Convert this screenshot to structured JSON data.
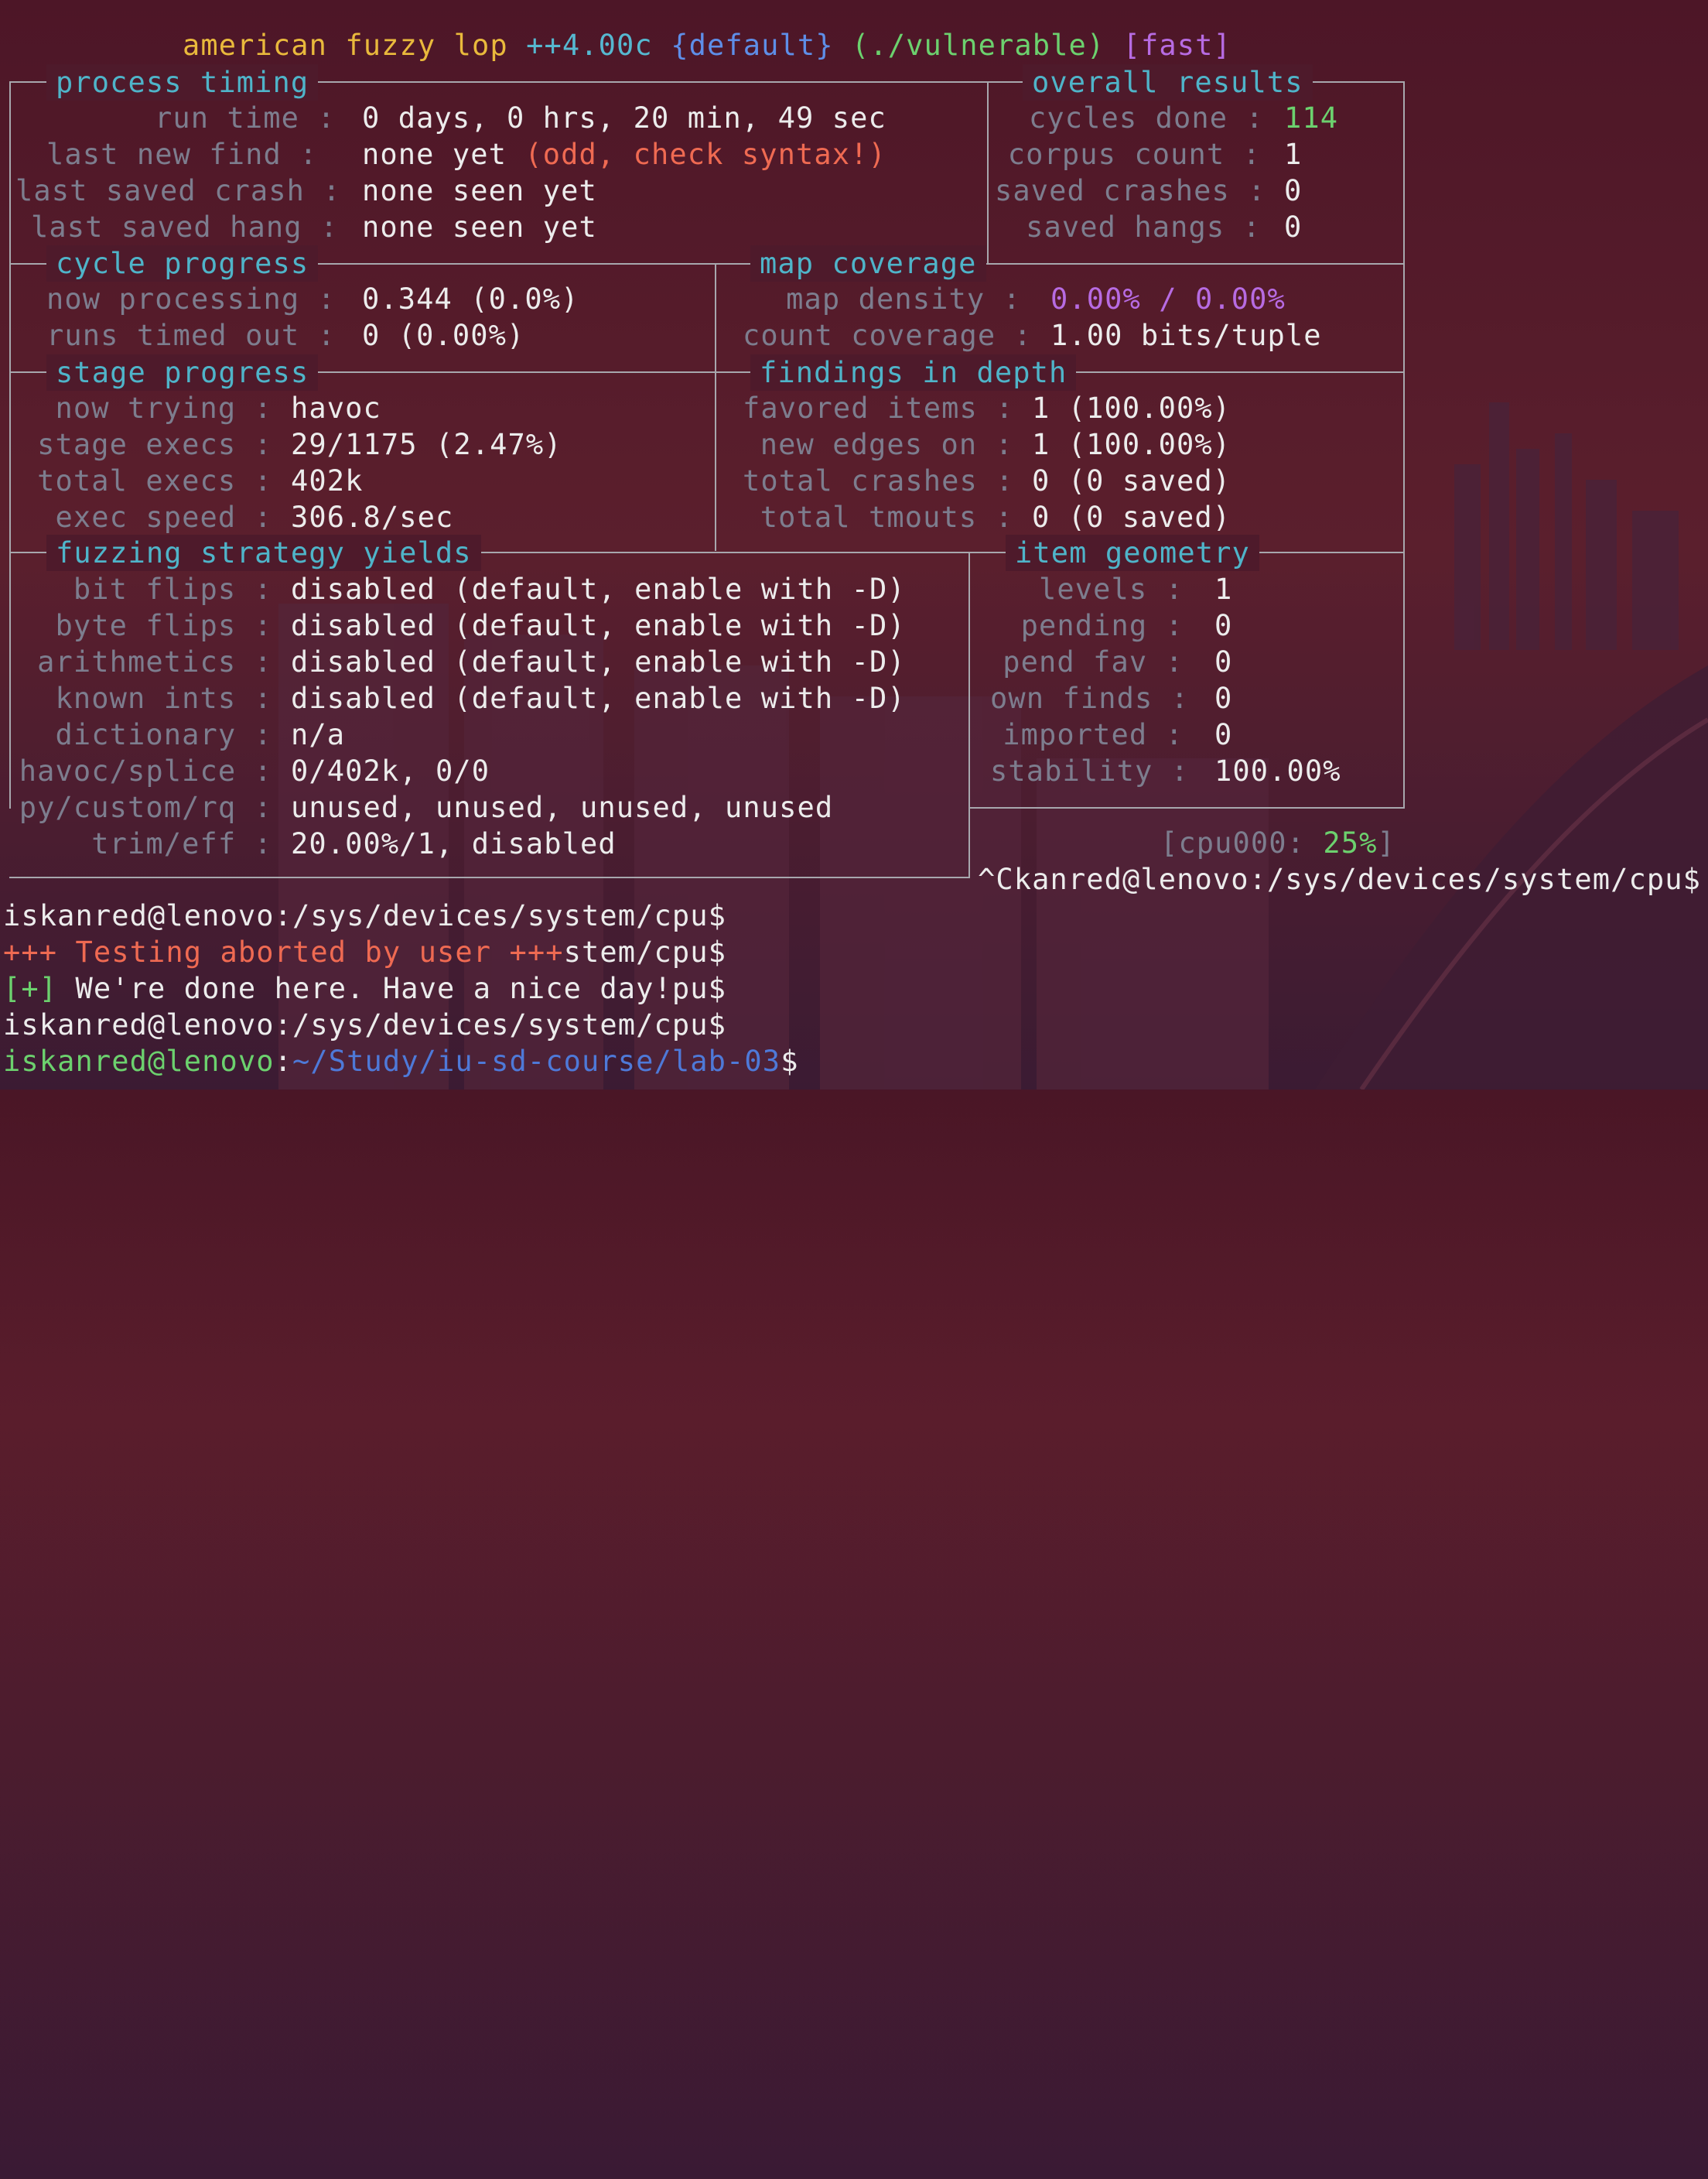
{
  "title": {
    "name": "american fuzzy lop",
    "version": "++4.00c",
    "profile": "{default}",
    "target": "(./vulnerable)",
    "mode": "[fast]"
  },
  "sections": {
    "process_timing": "process timing",
    "overall_results": "overall results",
    "cycle_progress": "cycle progress",
    "map_coverage": "map coverage",
    "stage_progress": "stage progress",
    "findings_in_depth": "findings in depth",
    "fuzzing_strategy_yields": "fuzzing strategy yields",
    "item_geometry": "item geometry"
  },
  "process_timing": {
    "run_time_label": "run time :",
    "run_time": "0 days, 0 hrs, 20 min, 49 sec",
    "last_new_find_label": "last new find :",
    "last_new_find": "none yet",
    "last_new_find_warn": "(odd, check syntax!)",
    "last_saved_crash_label": "last saved crash :",
    "last_saved_crash": "none seen yet",
    "last_saved_hang_label": "last saved hang :",
    "last_saved_hang": "none seen yet"
  },
  "overall_results": {
    "cycles_done_label": "cycles done :",
    "cycles_done": "114",
    "corpus_count_label": "corpus count :",
    "corpus_count": "1",
    "saved_crashes_label": "saved crashes :",
    "saved_crashes": "0",
    "saved_hangs_label": "saved hangs :",
    "saved_hangs": "0"
  },
  "cycle_progress": {
    "now_processing_label": "now processing :",
    "now_processing": "0.344 (0.0%)",
    "runs_timed_out_label": "runs timed out :",
    "runs_timed_out": "0 (0.00%)"
  },
  "map_coverage": {
    "map_density_label": "map density :",
    "map_density": "0.00% / 0.00%",
    "count_coverage_label": "count coverage :",
    "count_coverage": "1.00 bits/tuple"
  },
  "stage_progress": {
    "now_trying_label": "now trying :",
    "now_trying": "havoc",
    "stage_execs_label": "stage execs :",
    "stage_execs": "29/1175 (2.47%)",
    "total_execs_label": "total execs :",
    "total_execs": "402k",
    "exec_speed_label": "exec speed :",
    "exec_speed": "306.8/sec"
  },
  "findings": {
    "favored_items_label": "favored items :",
    "favored_items": "1 (100.00%)",
    "new_edges_on_label": "new edges on :",
    "new_edges_on": "1 (100.00%)",
    "total_crashes_label": "total crashes :",
    "total_crashes": "0 (0 saved)",
    "total_tmouts_label": "total tmouts :",
    "total_tmouts": "0 (0 saved)"
  },
  "strategy": {
    "bit_flips_label": "bit flips :",
    "bit_flips": "disabled (default, enable with -D)",
    "byte_flips_label": "byte flips :",
    "byte_flips": "disabled (default, enable with -D)",
    "arithmetics_label": "arithmetics :",
    "arithmetics": "disabled (default, enable with -D)",
    "known_ints_label": "known ints :",
    "known_ints": "disabled (default, enable with -D)",
    "dictionary_label": "dictionary :",
    "dictionary": "n/a",
    "havoc_splice_label": "havoc/splice :",
    "havoc_splice": "0/402k, 0/0",
    "py_custom_rq_label": "py/custom/rq :",
    "py_custom_rq": "unused, unused, unused, unused",
    "trim_eff_label": "trim/eff :",
    "trim_eff": "20.00%/1, disabled"
  },
  "item_geometry": {
    "levels_label": "levels :",
    "levels": "1",
    "pending_label": "pending :",
    "pending": "0",
    "pend_fav_label": "pend fav :",
    "pend_fav": "0",
    "own_finds_label": "own finds :",
    "own_finds": "0",
    "imported_label": "imported :",
    "imported": "0",
    "stability_label": "stability :",
    "stability": "100.00%"
  },
  "cpu": {
    "prefix": "[cpu000:",
    "value": "25%",
    "suffix": "]"
  },
  "shell": {
    "ctrl_c_line": "^Ckanred@lenovo:/sys/devices/system/cpu$",
    "line1": "iskanred@lenovo:/sys/devices/system/cpu$",
    "aborted_text": "+++ Testing aborted by user +++",
    "aborted_tail": "stem/cpu$",
    "done_prefix": "[+]",
    "done_text": " We're done here. Have a nice day!",
    "done_tail": "pu$",
    "line4": "iskanred@lenovo:/sys/devices/system/cpu$",
    "prompt_user": "iskanred@lenovo",
    "prompt_colon": ":",
    "prompt_path": "~/Study/iu-sd-course/lab-03",
    "prompt_dollar": "$"
  },
  "colors": {
    "label": "#7d7d8e",
    "section": "#4fb4c9",
    "warning": "#ef6a52",
    "good": "#6cd16e",
    "density": "#b76be2",
    "title": "#e9b93c"
  }
}
